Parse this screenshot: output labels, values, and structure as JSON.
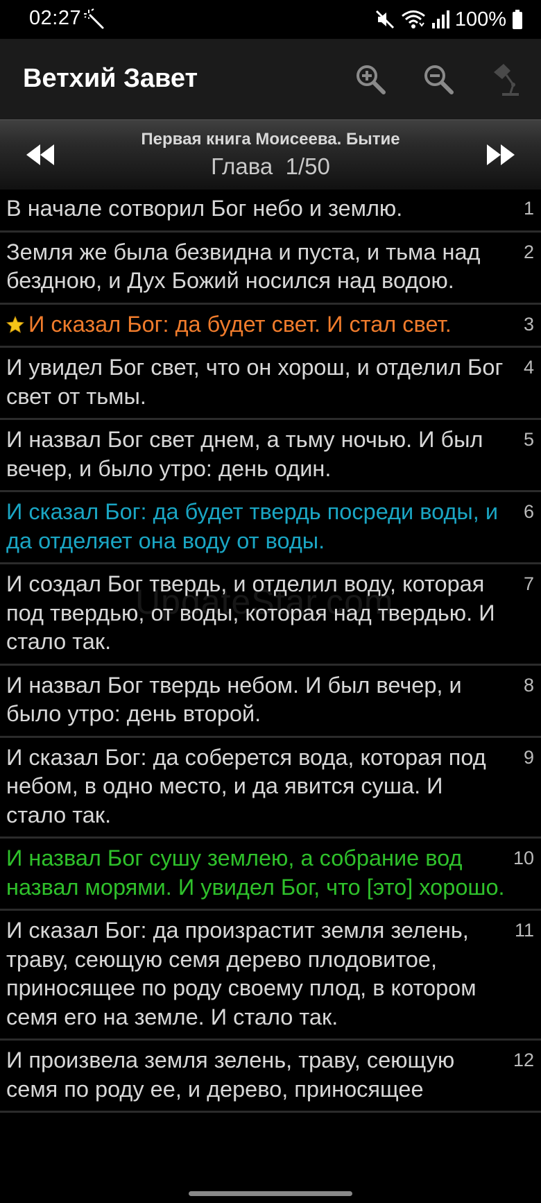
{
  "status_bar": {
    "time": "02:27",
    "battery": "100%",
    "icons": [
      "magic-wand-icon",
      "mute-icon",
      "wifi-icon",
      "signal-icon",
      "battery-icon"
    ]
  },
  "app_bar": {
    "title": "Ветхий Завет",
    "actions": [
      "zoom-in-icon",
      "zoom-out-icon",
      "lamp-icon"
    ]
  },
  "chapter_nav": {
    "book_title": "Первая книга Моисеева. Бытие",
    "chapter_label": "Глава  1/50",
    "prev_icon": "rewind-icon",
    "next_icon": "fast-forward-icon"
  },
  "colors": {
    "default_text": "#d8d8d8",
    "orange": "#f07c2c",
    "cyan": "#1aa6c4",
    "green": "#2fc12b",
    "star": "#f5c518"
  },
  "verses": [
    {
      "num": "1",
      "text": "В начале сотворил Бог небо и землю.",
      "color": "#d8d8d8",
      "starred": false
    },
    {
      "num": "2",
      "text": "Земля же была безвидна и пуста, и тьма над бездною, и Дух Божий носился над водою.",
      "color": "#d8d8d8",
      "starred": false
    },
    {
      "num": "3",
      "text": "И сказал Бог: да будет свет. И стал свет.",
      "color": "#f07c2c",
      "starred": true
    },
    {
      "num": "4",
      "text": "И увидел Бог свет, что он хорош, и отделил Бог свет от тьмы.",
      "color": "#d8d8d8",
      "starred": false
    },
    {
      "num": "5",
      "text": "И назвал Бог свет днем, а тьму ночью. И был вечер, и было утро: день один.",
      "color": "#d8d8d8",
      "starred": false
    },
    {
      "num": "6",
      "text": "И сказал Бог: да будет твердь посреди воды, и да отделяет она воду от воды.",
      "color": "#1aa6c4",
      "starred": false
    },
    {
      "num": "7",
      "text": "И создал Бог твердь, и отделил воду, которая под твердью, от воды, которая над твердью. И стало так.",
      "color": "#d8d8d8",
      "starred": false
    },
    {
      "num": "8",
      "text": "И назвал Бог твердь небом. И был вечер, и было утро: день второй.",
      "color": "#d8d8d8",
      "starred": false
    },
    {
      "num": "9",
      "text": "И сказал Бог: да соберется вода, которая под небом, в одно место, и да явится суша. И стало так.",
      "color": "#d8d8d8",
      "starred": false
    },
    {
      "num": "10",
      "text": "И назвал Бог сушу землею, а собрание вод назвал морями. И увидел Бог, что [это] хорошо.",
      "color": "#2fc12b",
      "starred": false
    },
    {
      "num": "11",
      "text": "И сказал Бог: да произрастит земля зелень, траву, сеющую семя дерево плодовитое, приносящее по роду своему плод, в котором семя его на земле. И стало так.",
      "color": "#d8d8d8",
      "starred": false
    },
    {
      "num": "12",
      "text": "И произвела земля зелень, траву, сеющую семя по роду ее, и дерево, приносящее",
      "color": "#d8d8d8",
      "starred": false
    }
  ],
  "watermark": "UpdateStar.com"
}
